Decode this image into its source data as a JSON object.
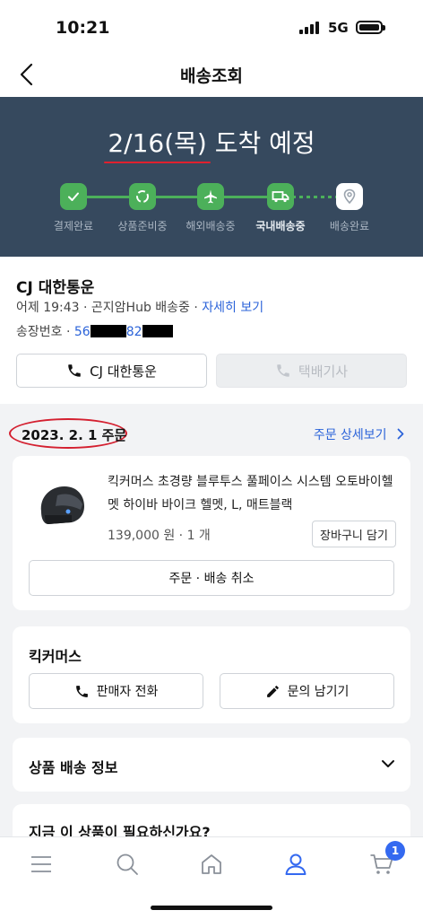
{
  "status_bar": {
    "time": "10:21",
    "network": "5G"
  },
  "nav": {
    "title": "배송조회"
  },
  "hero": {
    "date": "2/16(목)",
    "suffix": " 도착 예정",
    "steps": [
      {
        "label": "결제완료",
        "icon": "check-icon"
      },
      {
        "label": "상품준비중",
        "icon": "refresh-icon"
      },
      {
        "label": "해외배송중",
        "icon": "airplane-icon"
      },
      {
        "label": "국내배송중",
        "icon": "truck-icon"
      },
      {
        "label": "배송완료",
        "icon": "location-pin-icon"
      }
    ],
    "current_step": 4
  },
  "carrier": {
    "name": "CJ 대한통운",
    "status_text": "어제 19:43 · 곤지암Hub 배송중 · ",
    "detail_link": "자세히 보기",
    "invoice_label": "송장번호 · ",
    "invoice_part1": "56",
    "invoice_part2": "82",
    "call_carrier_label": "CJ 대한통운",
    "call_driver_label": "택배기사"
  },
  "order": {
    "date": "2023. 2. 1 주문",
    "detail_link": "주문 상세보기"
  },
  "product": {
    "name": "킥커머스 초경량 블루투스 풀페이스 시스템 오토바이헬멧 하이바 바이크 헬멧, L, 매트블랙",
    "price": "139,000 원 · 1 개",
    "cart_label": "장바구니 담기",
    "cancel_label": "주문 · 배송 취소"
  },
  "seller": {
    "name": "킥커머스",
    "call_label": "판매자 전화",
    "inquiry_label": "문의 남기기"
  },
  "shipping_info": {
    "label": "상품 배송 정보"
  },
  "recommend": {
    "label": "지금 이 상품이 필요하신가요?"
  },
  "tabbar": {
    "cart_count": "1"
  },
  "colors": {
    "hero_bg": "#36495e",
    "step_green": "#4cb05a",
    "link_blue": "#2b63d9",
    "badge_blue": "#3469f0"
  }
}
